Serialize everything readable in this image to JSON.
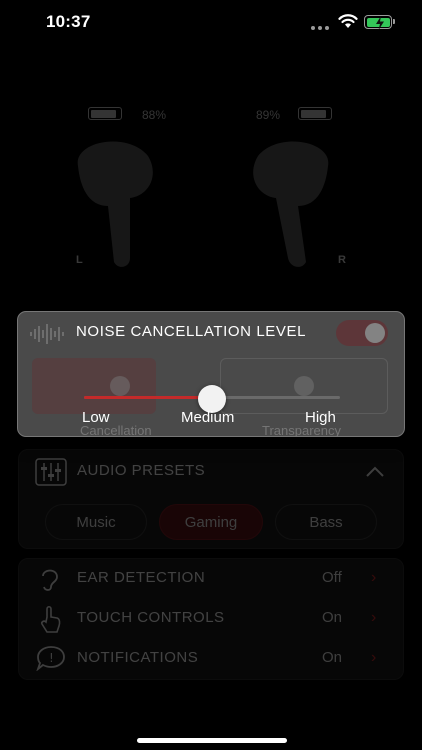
{
  "status_bar": {
    "time": "10:37"
  },
  "earbuds": {
    "left": {
      "battery": "88%",
      "label": "L"
    },
    "right": {
      "battery": "89%",
      "label": "R"
    }
  },
  "noise_popup": {
    "title": "NOISE CANCELLATION LEVEL",
    "levels": [
      "Low",
      "Medium",
      "High"
    ],
    "selected_index": 1,
    "behind_labels": {
      "left": "Cancellation",
      "right": "Transparency"
    }
  },
  "audio_presets": {
    "title": "AUDIO PRESETS",
    "chips": [
      "Music",
      "Gaming",
      "Bass"
    ],
    "active_chip": "Gaming"
  },
  "settings": [
    {
      "label": "EAR DETECTION",
      "value": "Off"
    },
    {
      "label": "TOUCH CONTROLS",
      "value": "On"
    },
    {
      "label": "NOTIFICATIONS",
      "value": "On"
    }
  ],
  "colors": {
    "accent": "#c42a2a",
    "popup_bg": "#4a4a4a",
    "background": "#000000"
  }
}
